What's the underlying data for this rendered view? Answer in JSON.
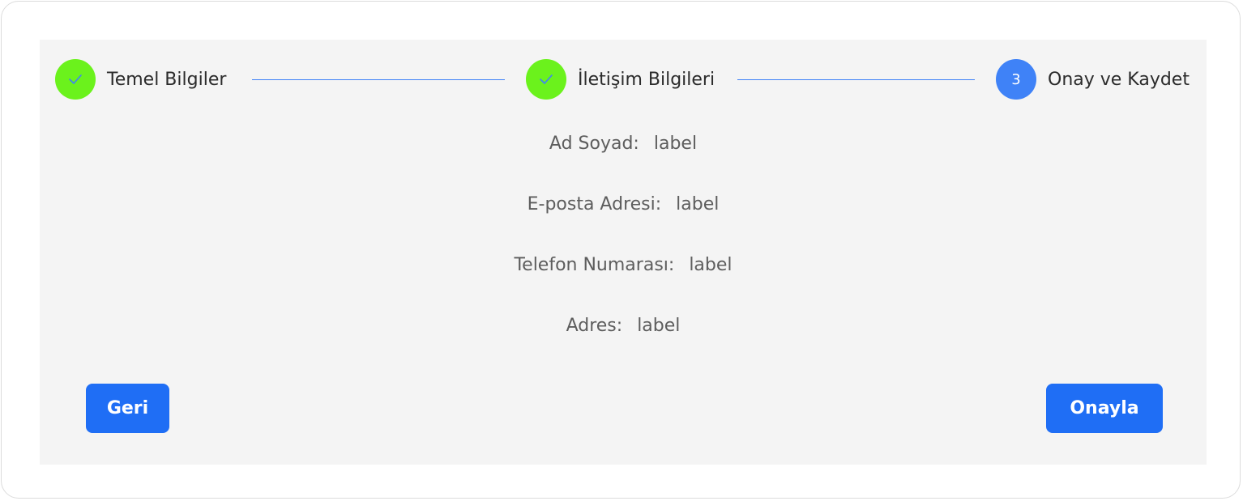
{
  "stepper": {
    "steps": [
      {
        "label": "Temel Bilgiler",
        "state": "done",
        "icon": "check-icon"
      },
      {
        "label": "İletişim Bilgileri",
        "state": "done",
        "icon": "check-icon"
      },
      {
        "label": "Onay ve Kaydet",
        "state": "active",
        "number": "3"
      }
    ]
  },
  "details": {
    "full_name": {
      "label": "Ad Soyad:",
      "value": "label"
    },
    "email": {
      "label": "E-posta Adresi:",
      "value": "label"
    },
    "phone": {
      "label": "Telefon Numarası:",
      "value": "label"
    },
    "address": {
      "label": "Adres:",
      "value": "label"
    }
  },
  "actions": {
    "back_label": "Geri",
    "confirm_label": "Onayla"
  },
  "colors": {
    "completed_step": "#6bf21c",
    "active_step": "#3f82f7",
    "connector": "#3f82f7",
    "button": "#1f6ef5",
    "panel_background": "#f4f4f4"
  }
}
